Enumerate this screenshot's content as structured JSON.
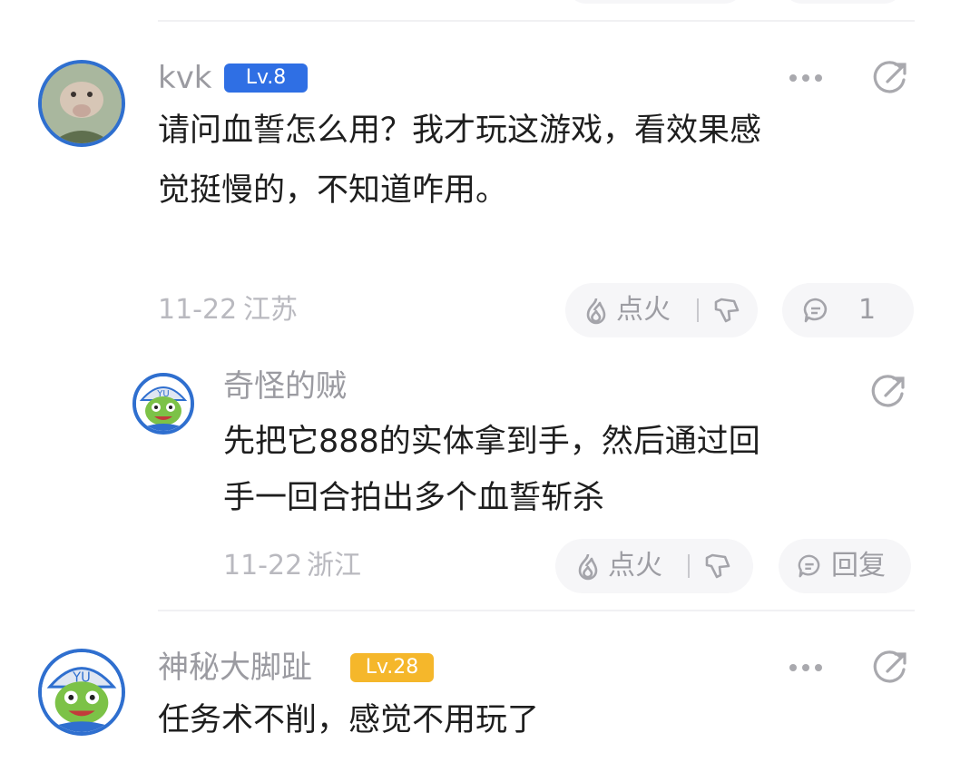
{
  "comments": [
    {
      "username": "kvk",
      "level": "Lv.8",
      "text_lines": [
        "请问血誓怎么用？我才玩这游戏，看效果感",
        "觉挺慢的，不知道咋用。"
      ],
      "date": "11-22",
      "location": "江苏",
      "fire_label": "点火",
      "reply_count": "1",
      "replies": [
        {
          "username": "奇怪的贼",
          "text_lines": [
            "先把它888的实体拿到手，然后通过回",
            "手一回合拍出多个血誓斩杀"
          ],
          "date": "11-22",
          "location": "浙江",
          "fire_label": "点火",
          "reply_label": "回复"
        }
      ]
    },
    {
      "username": "神秘大脚趾",
      "level": "Lv.28",
      "text_lines": [
        "任务术不削，感觉不用玩了"
      ]
    }
  ],
  "colors": {
    "level_low": "#2f6fe4",
    "level_high": "#f5b72b",
    "text": "#1e1e1e",
    "muted": "#9b9ba1"
  },
  "icons": [
    "more-icon",
    "share-icon",
    "fire-icon",
    "thumbs-down-icon",
    "chat-bubble-icon"
  ]
}
